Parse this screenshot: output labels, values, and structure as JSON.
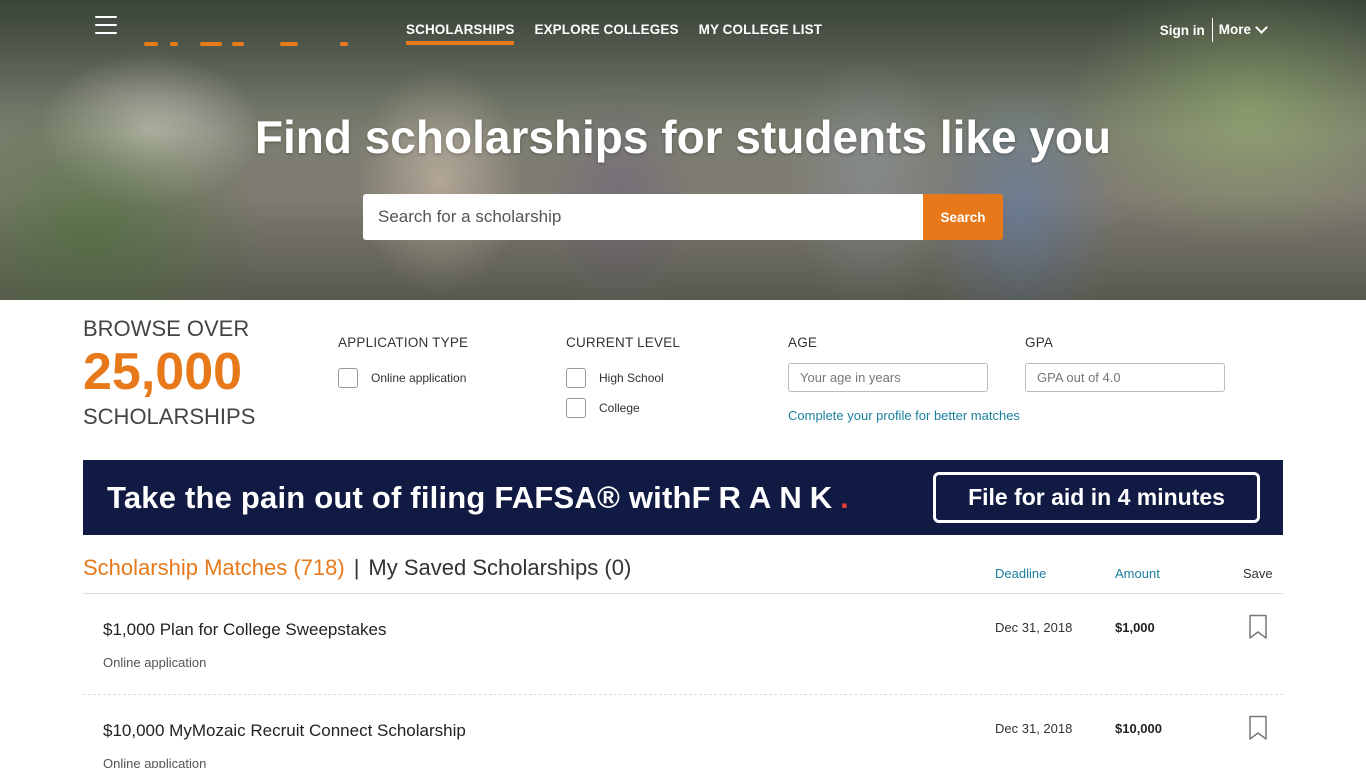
{
  "header": {
    "nav": [
      {
        "label": "SCHOLARSHIPS",
        "active": true
      },
      {
        "label": "EXPLORE COLLEGES",
        "active": false
      },
      {
        "label": "MY COLLEGE LIST",
        "active": false
      }
    ],
    "signin_label": "Sign in",
    "more_label": "More",
    "accent_color": "#e7791b"
  },
  "hero": {
    "title": "Find scholarships for students like you",
    "search_placeholder": "Search for a scholarship",
    "search_button": "Search"
  },
  "browse": {
    "pre": "BROWSE OVER",
    "count": "25,000",
    "post": "SCHOLARSHIPS"
  },
  "filters": {
    "application_type": {
      "label": "APPLICATION TYPE",
      "options": [
        "Online application"
      ]
    },
    "current_level": {
      "label": "CURRENT LEVEL",
      "options": [
        "High School",
        "College"
      ]
    },
    "age": {
      "label": "AGE",
      "placeholder": "Your age in years"
    },
    "gpa": {
      "label": "GPA",
      "placeholder": "GPA out of 4.0"
    },
    "profile_link": "Complete your profile for better matches"
  },
  "banner": {
    "text_prefix": "Take the pain out of filing FAFSA® with",
    "brand": "FRANK",
    "brand_dot": ".",
    "button": "File for aid in 4 minutes",
    "bg_color": "#101a42"
  },
  "tabs": {
    "matches": "Scholarship Matches (718)",
    "separator": "|",
    "saved": "My Saved Scholarships (0)"
  },
  "columns": {
    "deadline": "Deadline",
    "amount": "Amount",
    "save": "Save"
  },
  "scholarships": [
    {
      "title": "$1,000 Plan for College Sweepstakes",
      "type": "Online application",
      "deadline": "Dec 31, 2018",
      "amount": "$1,000"
    },
    {
      "title": "$10,000 MyMozaic Recruit Connect Scholarship",
      "type": "Online application",
      "deadline": "Dec 31, 2018",
      "amount": "$10,000"
    }
  ]
}
